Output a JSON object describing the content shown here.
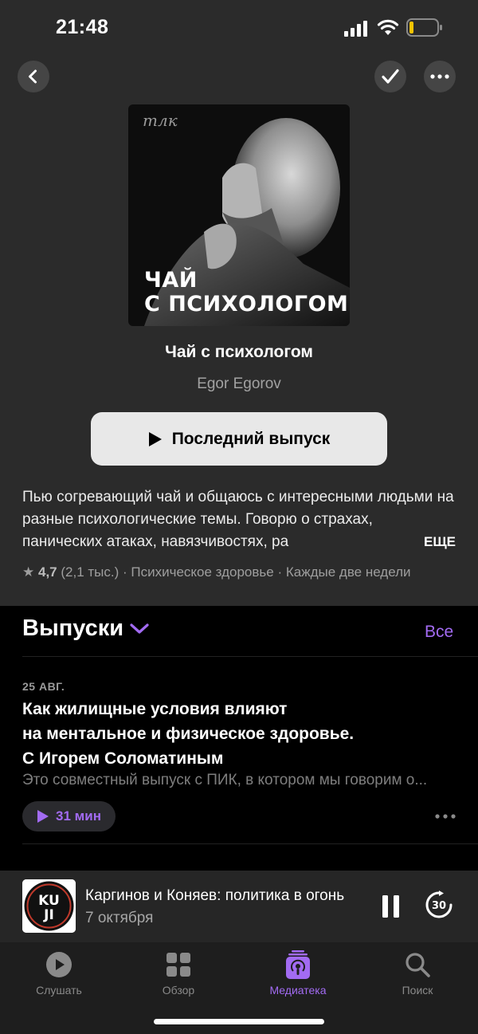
{
  "status": {
    "time": "21:48"
  },
  "header": {
    "back_icon": "chevron-left-icon",
    "check_icon": "checkmark-icon",
    "more_icon": "ellipsis-icon"
  },
  "cover": {
    "logo": "тлк",
    "title_line1": "ЧАЙ",
    "title_line2": "С ПСИХОЛОГОМ"
  },
  "podcast": {
    "title": "Чай с психологом",
    "author": "Egor Egorov",
    "play_button": "Последний выпуск",
    "description": "Пью согревающий чай и общаюсь с интересными людьми на разные психологические темы. Говорю о страхах, панических атаках, навязчивостях, ра",
    "more": "ЕЩЕ",
    "rating": "4,7",
    "rating_count": "(2,1 тыс.)",
    "category": "Психическое здоровье",
    "frequency": "Каждые две недели"
  },
  "episodes": {
    "header": "Выпуски",
    "see_all": "Все",
    "items": [
      {
        "date": "25 АВГ.",
        "title_line1": "Как жилищные условия влияют",
        "title_line2": "на ментальное и физическое здоровье.",
        "title_line3": "С Игорем Соломатиным",
        "description": "Это совместный выпуск с ПИК, в котором мы говорим о...",
        "duration": "31 мин"
      }
    ]
  },
  "mini_player": {
    "art_text_top": "KU",
    "art_text_bottom": "JI",
    "title": "Каргинов и Коняев: политика в огонь",
    "subtitle": "7 октября",
    "skip_label": "30"
  },
  "tabs": [
    {
      "label": "Слушать",
      "icon": "play-circle-icon"
    },
    {
      "label": "Обзор",
      "icon": "grid-icon"
    },
    {
      "label": "Медиатека",
      "icon": "library-icon",
      "active": true
    },
    {
      "label": "Поиск",
      "icon": "search-icon"
    }
  ],
  "colors": {
    "accent": "#a26bf2",
    "background": "#000000",
    "header_bg": "#2b2b2b"
  }
}
